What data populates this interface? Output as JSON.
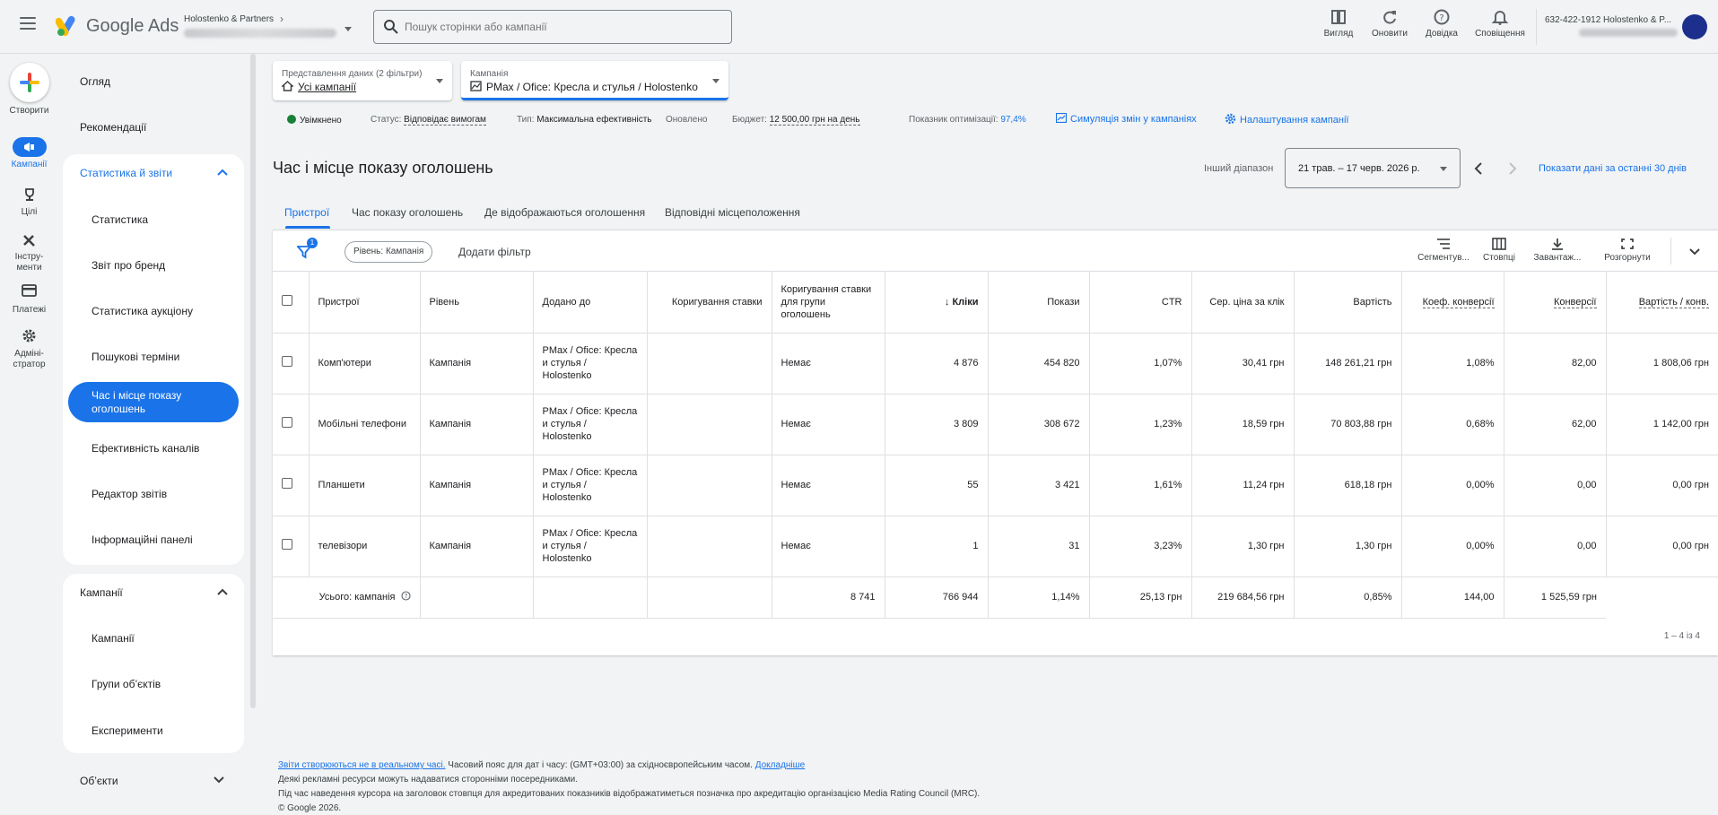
{
  "header": {
    "brand": "Google Ads",
    "account_name": "Holostenko & Partners",
    "search_placeholder": "Пошук сторінки або кампанії",
    "tools": [
      "Вигляд",
      "Оновити",
      "Довідка",
      "Сповіщення"
    ],
    "user_line": "632-422-1912 Holostenko & P..."
  },
  "rail": {
    "create": "Створити",
    "items": [
      "Кампанії",
      "Цілі",
      "Інстру-\nменти",
      "Платежі",
      "Адміні-\nстратор"
    ]
  },
  "nav": {
    "overview": "Огляд",
    "recommendations": "Рекомендації",
    "stats_group": {
      "title": "Статистика й звіти",
      "items": [
        "Статистика",
        "Звіт про бренд",
        "Статистика аукціону",
        "Пошукові терміни",
        "Час і місце показу оголошень",
        "Ефективність каналів",
        "Редактор звітів",
        "Інформаційні панелі"
      ]
    },
    "campaigns_group": {
      "title": "Кампанії",
      "items": [
        "Кампанії",
        "Групи об’єктів",
        "Експерименти"
      ]
    },
    "objects": "Об’єкти"
  },
  "filters": {
    "view_label": "Представлення даних (2 фільтри)",
    "view_value": "Усі кампанії",
    "campaign_label": "Кампанія",
    "campaign_value": "PMax / Ofice: Кресла и стулья / Holostenko"
  },
  "status": {
    "enabled": "Увімкнено",
    "status_label": "Статус:",
    "status_value": "Відповідає вимогам",
    "type_label": "Тип:",
    "type_value": "Максимальна ефективність",
    "updated": "Оновлено",
    "budget_label": "Бюджет:",
    "budget_value": "12 500,00 грн на день",
    "opt_label": "Показник оптимізації:",
    "opt_value": "97,4%",
    "simulate": "Симуляція змін у кампаніях",
    "settings": "Налаштування кампанії"
  },
  "page": {
    "title": "Час і місце показу оголошень",
    "range_label": "Інший діапазон",
    "range_value": "21 трав. – 17 черв. 2026 р.",
    "last30": "Показати дані за останні 30 днів"
  },
  "tabs": [
    "Пристрої",
    "Час показу оголошень",
    "Де відображаються оголошення",
    "Відповідні місцеположення"
  ],
  "toolbar": {
    "filter_badge": "1",
    "chip": "Рівень: Кампанія",
    "add_filter": "Додати фільтр",
    "buttons": [
      "Сегментув...",
      "Стовпці",
      "Завантаж...",
      "Розгорнути"
    ]
  },
  "table": {
    "headers": [
      "Пристрої",
      "Рівень",
      "Додано до",
      "Коригування ставки",
      "Коригування ставки для групи оголошень",
      "Кліки",
      "Покази",
      "CTR",
      "Сер. ціна за клік",
      "Вартість",
      "Коеф. конверсії",
      "Конверсії",
      "Вартість / конв."
    ],
    "sort_arrow": "↓",
    "rows": [
      [
        "Комп'ютери",
        "Кампанія",
        "PMax / Ofice: Кресла и стулья / Holostenko",
        "",
        "Немає",
        "4 876",
        "454 820",
        "1,07%",
        "30,41 грн",
        "148 261,21 грн",
        "1,08%",
        "82,00",
        "1 808,06 грн"
      ],
      [
        "Мобільні телефони",
        "Кампанія",
        "PMax / Ofice: Кресла и стулья / Holostenko",
        "",
        "Немає",
        "3 809",
        "308 672",
        "1,23%",
        "18,59 грн",
        "70 803,88 грн",
        "0,68%",
        "62,00",
        "1 142,00 грн"
      ],
      [
        "Планшети",
        "Кампанія",
        "PMax / Ofice: Кресла и стулья / Holostenko",
        "",
        "Немає",
        "55",
        "3 421",
        "1,61%",
        "11,24 грн",
        "618,18 грн",
        "0,00%",
        "0,00",
        "0,00 грн"
      ],
      [
        "телевізори",
        "Кампанія",
        "PMax / Ofice: Кресла и стулья / Holostenko",
        "",
        "Немає",
        "1",
        "31",
        "3,23%",
        "1,30 грн",
        "1,30 грн",
        "0,00%",
        "0,00",
        "0,00 грн"
      ]
    ],
    "total": [
      "Усього: кампанія",
      "8 741",
      "766 944",
      "1,14%",
      "25,13 грн",
      "219 684,56 грн",
      "0,85%",
      "144,00",
      "1 525,59 грн"
    ],
    "pager": "1 – 4 із 4"
  },
  "footer": {
    "line1_link": "Звіти створюються не в реальному часі.",
    "line1_text": " Часовий пояс для дат і часу: (GMT+03:00) за східноєвропейським часом. ",
    "line1_more": "Докладніше",
    "line2": "Деякі рекламні ресурси можуть надаватися сторонніми посередниками.",
    "line3": "Під час наведення курсора на заголовок стовпця для акредитованих показників відображатиметься позначка про акредитацію організацією Media Rating Council (MRC).",
    "line4": "© Google 2026."
  }
}
